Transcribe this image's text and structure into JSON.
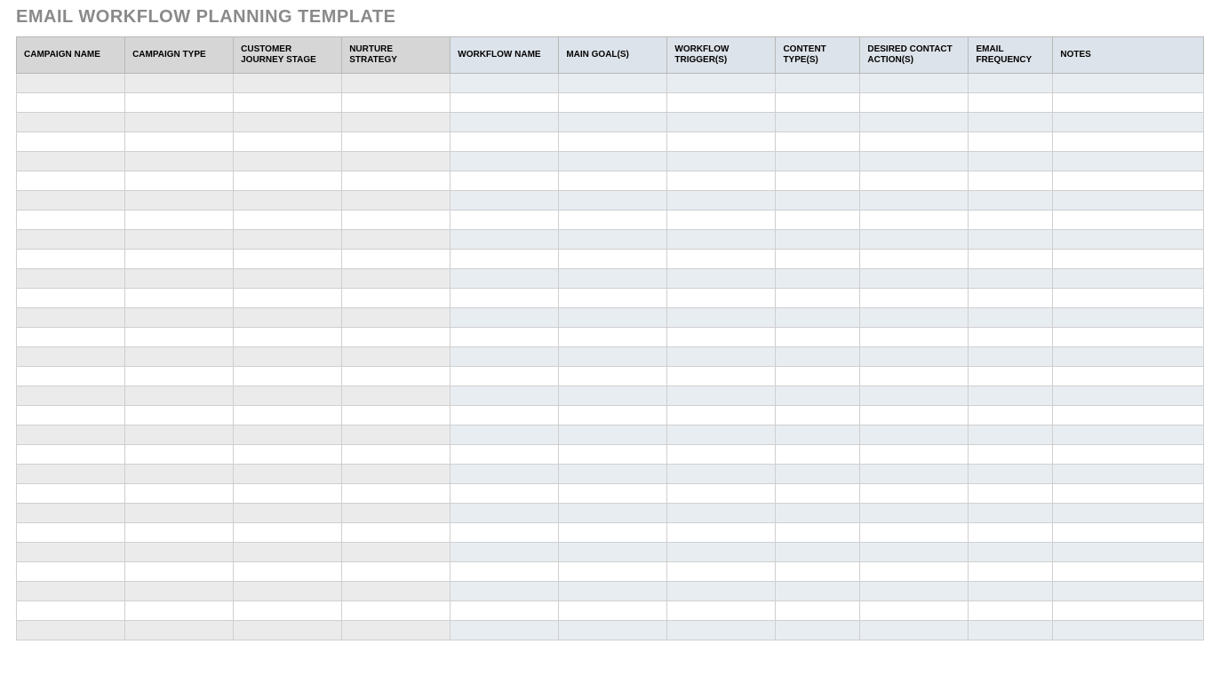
{
  "title": "EMAIL WORKFLOW PLANNING TEMPLATE",
  "columns": [
    {
      "label": "CAMPAIGN NAME",
      "group": "grey"
    },
    {
      "label": "CAMPAIGN TYPE",
      "group": "grey"
    },
    {
      "label": "CUSTOMER JOURNEY STAGE",
      "group": "grey"
    },
    {
      "label": "NURTURE STRATEGY",
      "group": "grey"
    },
    {
      "label": "WORKFLOW NAME",
      "group": "blue"
    },
    {
      "label": "MAIN GOAL(S)",
      "group": "blue"
    },
    {
      "label": "WORKFLOW TRIGGER(S)",
      "group": "blue"
    },
    {
      "label": "CONTENT TYPE(S)",
      "group": "blue"
    },
    {
      "label": "DESIRED CONTACT ACTION(S)",
      "group": "blue"
    },
    {
      "label": "EMAIL FREQUENCY",
      "group": "blue"
    },
    {
      "label": "NOTES",
      "group": "blue"
    }
  ],
  "row_count": 29
}
